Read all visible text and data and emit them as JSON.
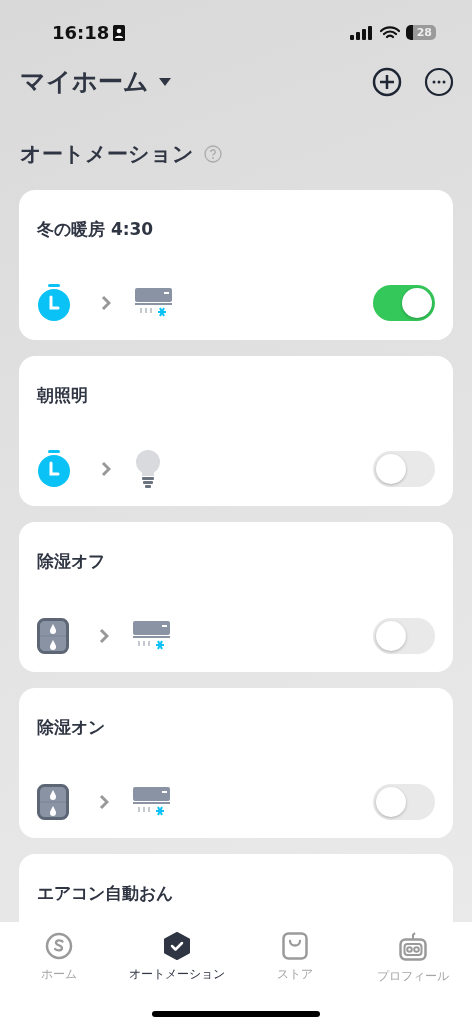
{
  "status_bar": {
    "time": "16:18",
    "battery": "28"
  },
  "header": {
    "title": "マイホーム"
  },
  "section": {
    "title": "オートメーション"
  },
  "automations": [
    {
      "title": "冬の暖房 4:30",
      "trigger": {
        "kind": "timer"
      },
      "action": {
        "kind": "aircon"
      },
      "on": true
    },
    {
      "title": "朝照明",
      "trigger": {
        "kind": "timer"
      },
      "action": {
        "kind": "bulb"
      },
      "on": false
    },
    {
      "title": "除湿オフ",
      "trigger": {
        "kind": "sensor"
      },
      "action": {
        "kind": "aircon"
      },
      "on": false
    },
    {
      "title": "除湿オン",
      "trigger": {
        "kind": "sensor"
      },
      "action": {
        "kind": "aircon"
      },
      "on": false
    },
    {
      "title": "エアコン自動おん"
    }
  ],
  "tabs": [
    {
      "label": "ホーム",
      "kind": "home",
      "selected": false
    },
    {
      "label": "オートメーション",
      "kind": "automation",
      "selected": true
    },
    {
      "label": "ストア",
      "kind": "store",
      "selected": false
    },
    {
      "label": "プロフィール",
      "kind": "profile",
      "selected": false
    }
  ]
}
